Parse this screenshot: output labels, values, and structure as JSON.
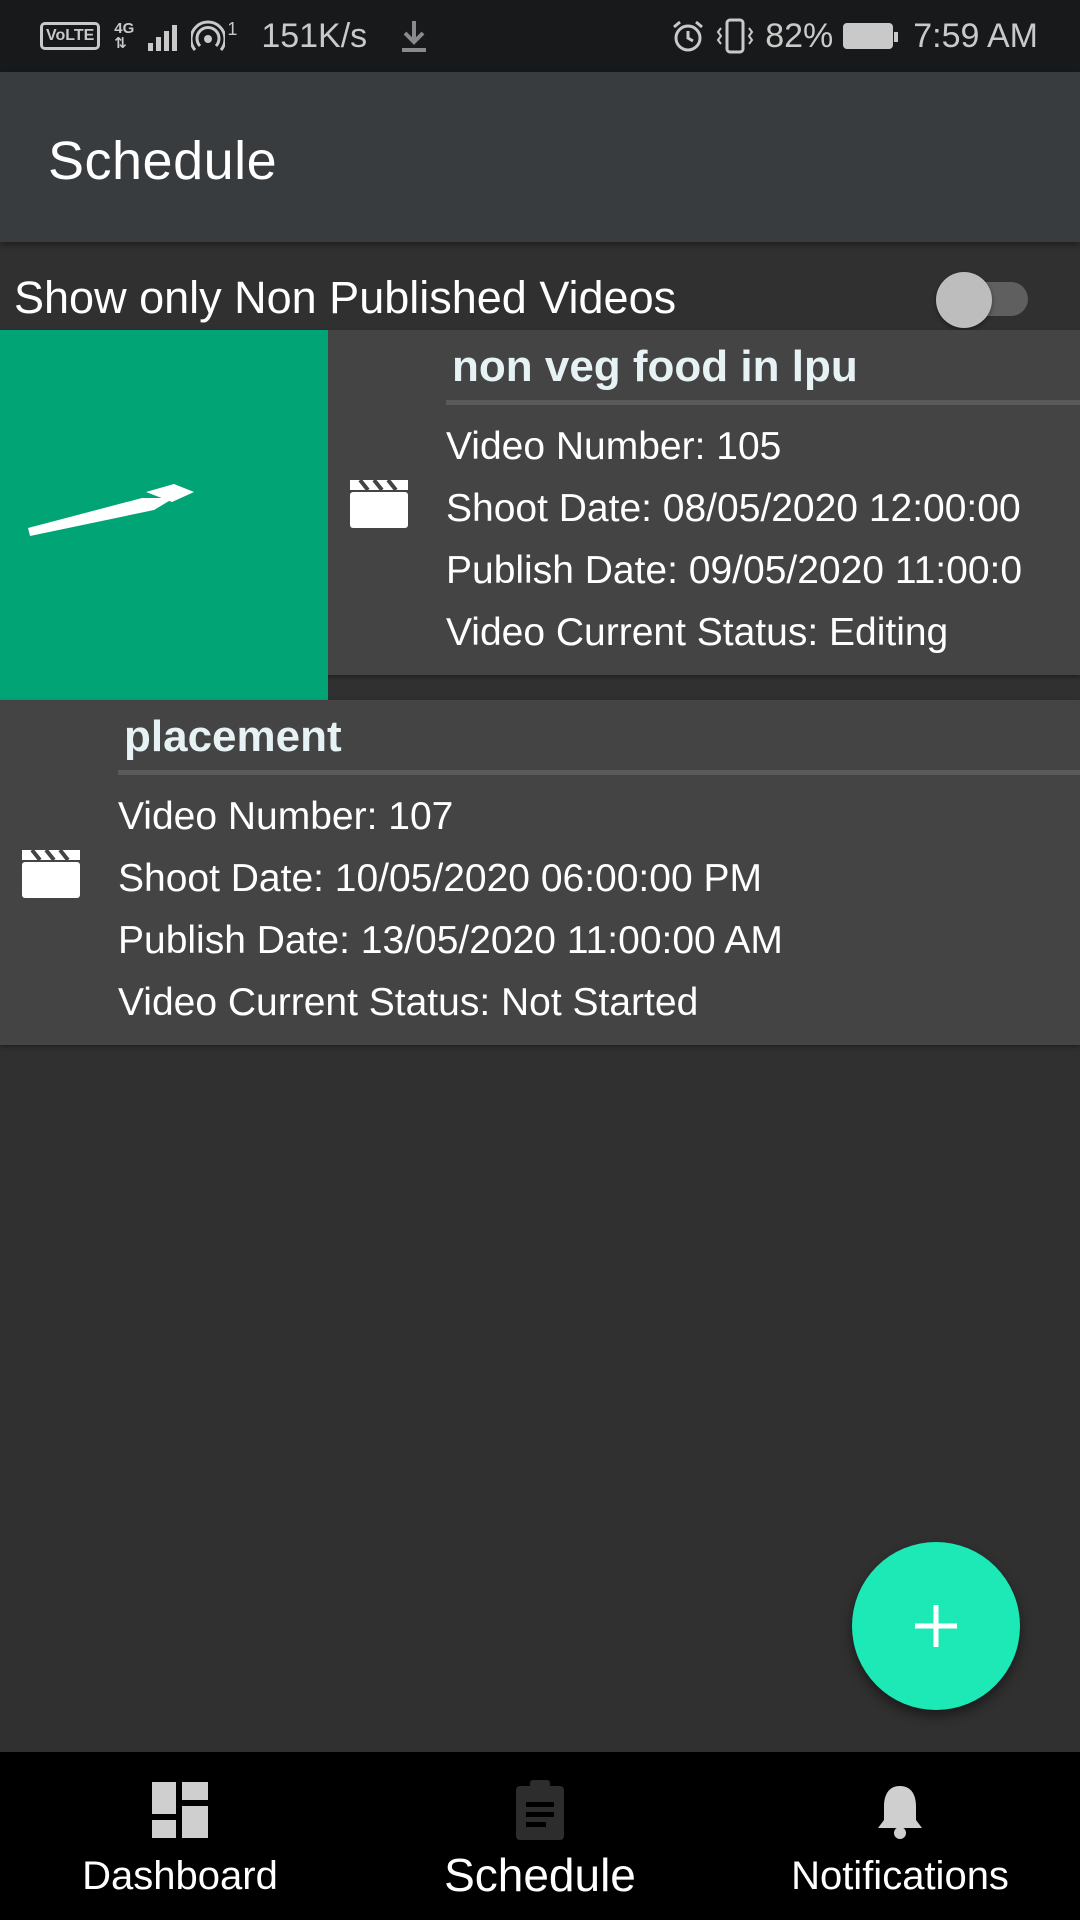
{
  "status_bar": {
    "volte": "VoLTE",
    "network": "4G",
    "hotspot_count": "1",
    "speed": "151K/s",
    "battery": "82%",
    "time": "7:59 AM"
  },
  "app_bar": {
    "title": "Schedule"
  },
  "filter": {
    "label": "Show only Non Published Videos",
    "toggle_on": false
  },
  "videos": [
    {
      "title": "non veg food in lpu",
      "number_line": "Video Number: 105",
      "shoot_line": "Shoot Date: 08/05/2020 12:00:00",
      "publish_line": "Publish Date: 09/05/2020 11:00:0",
      "status_line": "Video Current Status: Editing",
      "swipe_action_color": "#00a475",
      "swipe_action_icon": "edit-pencil-icon"
    },
    {
      "title": "placement",
      "number_line": "Video Number: 107",
      "shoot_line": "Shoot Date: 10/05/2020 06:00:00 PM",
      "publish_line": "Publish Date: 13/05/2020 11:00:00 AM",
      "status_line": "Video Current Status: Not Started"
    }
  ],
  "fab": {
    "icon": "plus-icon",
    "color": "#1de9b6"
  },
  "bottom_nav": {
    "items": [
      {
        "label": "Dashboard",
        "icon": "dashboard-icon"
      },
      {
        "label": "Schedule",
        "icon": "clipboard-icon",
        "active": true
      },
      {
        "label": "Notifications",
        "icon": "bell-icon"
      }
    ]
  }
}
